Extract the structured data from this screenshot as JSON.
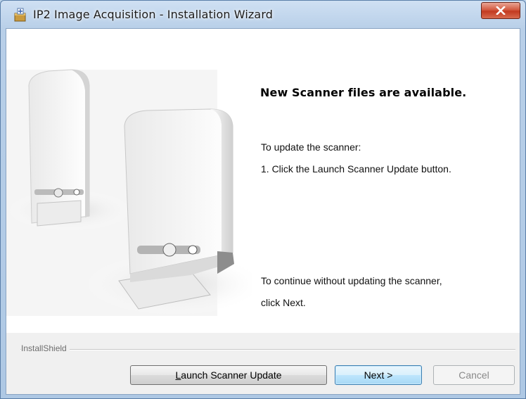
{
  "window": {
    "title": "IP2 Image Acquisition - Installation Wizard"
  },
  "main": {
    "heading": "New Scanner files are available.",
    "instructions_intro": "To update the scanner:",
    "instructions_step1": "1. Click the Launch Scanner Update button.",
    "continue_line1": "To continue without updating the scanner,",
    "continue_line2": "click Next."
  },
  "footer": {
    "brand": "InstallShield",
    "launch_prefix": "",
    "launch_accel": "L",
    "launch_rest": "aunch Scanner Update",
    "next_label": "Next >",
    "cancel_label": "Cancel"
  },
  "colors": {
    "titlebar": "#bcd3ea",
    "close_button": "#c94a30",
    "default_button_border": "#3c7fb1"
  },
  "icons": [
    "installer-icon",
    "close-icon"
  ]
}
